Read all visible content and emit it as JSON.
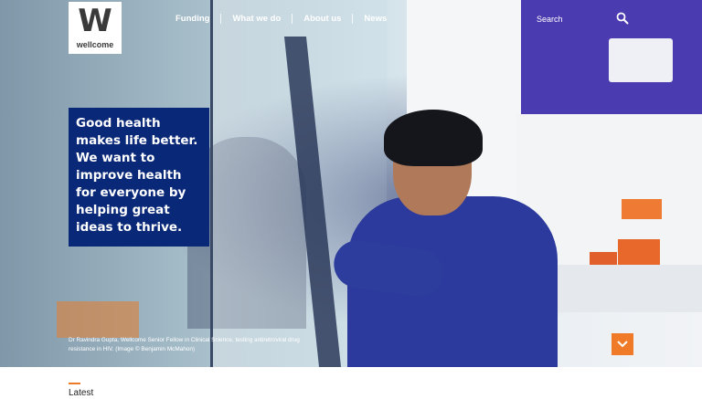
{
  "brand": {
    "logo_mark": "W",
    "logo_text": "wellcome"
  },
  "nav": {
    "items": [
      "Funding",
      "What we do",
      "About us",
      "News"
    ]
  },
  "search": {
    "label": "Search",
    "icon": "search-icon"
  },
  "hero": {
    "headline": "Good health makes life better. We want to improve health for everyone by helping great ideas to thrive.",
    "caption": "Dr Ravindra Gupta, Wellcome Senior Fellow in Clinical Science, testing antiretroviral drug resistance in HIV. (Image © Benjamin McMahon)",
    "scroll_icon": "chevron-down-icon"
  },
  "latest": {
    "heading": "Latest"
  },
  "colors": {
    "callout": "#0a2878",
    "accent": "#ef7b29",
    "white": "#ffffff"
  }
}
